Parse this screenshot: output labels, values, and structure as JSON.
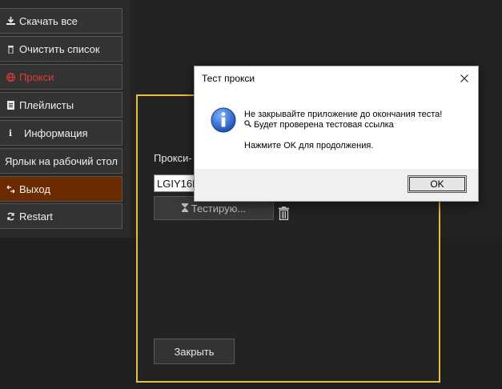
{
  "sidebar": {
    "items": [
      {
        "label": "Скачать все",
        "icon": "download-icon"
      },
      {
        "label": "Очистить список",
        "icon": "trash-icon"
      },
      {
        "label": "Прокси",
        "icon": "globe-icon",
        "active": true
      },
      {
        "label": "Плейлисты",
        "icon": "playlist-icon"
      },
      {
        "label": "Информация",
        "icon": "info-icon"
      },
      {
        "label": "Ярлык на рабочий стол",
        "icon": ""
      },
      {
        "label": "Выход",
        "icon": "exit-icon"
      },
      {
        "label": "Restart",
        "icon": "restart-icon"
      }
    ]
  },
  "panel": {
    "proxy_label": "Прокси-",
    "proxy_value": "LGIY16M",
    "test_button": "Тестирую...",
    "close_button": "Закрыть"
  },
  "dialog": {
    "title": "Тест прокси",
    "line1": "Не закрывайте приложение до окончания теста!",
    "line2": "Будет проверена тестовая ссылка",
    "line3": "Нажмите OK для продолжения.",
    "ok_button": "OK"
  },
  "colors": {
    "accent_border": "#e5c03a",
    "active_item": "#e03a3a",
    "exit_bg": "#6b2a00"
  }
}
